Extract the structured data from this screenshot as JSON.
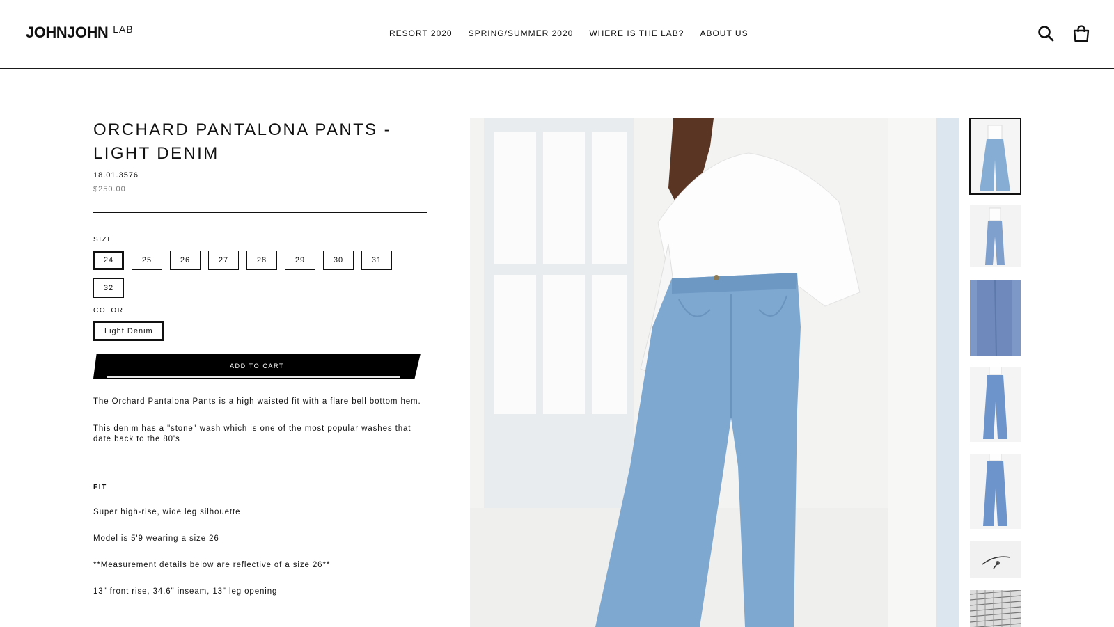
{
  "header": {
    "logo_main": "JOHNJOHN",
    "logo_sub": "LAB",
    "nav": [
      "RESORT 2020",
      "SPRING/SUMMER 2020",
      "WHERE IS THE LAB?",
      "ABOUT US"
    ],
    "icons": [
      "search-icon",
      "cart-icon"
    ]
  },
  "product": {
    "title": "ORCHARD PANTALONA PANTS - LIGHT DENIM",
    "sku": "18.01.3576",
    "price": "$250.00",
    "size_label": "SIZE",
    "sizes": [
      "24",
      "25",
      "26",
      "27",
      "28",
      "29",
      "30",
      "31",
      "32"
    ],
    "selected_size": "24",
    "color_label": "COLOR",
    "color_value": "Light Denim",
    "add_to_cart": "ADD TO CART",
    "description": [
      "The Orchard Pantalona Pants is a high waisted fit with a flare bell bottom hem.",
      "This denim has a \"stone\" wash which is one of the most popular washes that date back to the 80's"
    ],
    "fit_label": "FIT",
    "fit_lines": [
      "Super high-rise, wide leg silhouette",
      "Model is 5'9 wearing a size 26",
      "**Measurement details below are reflective of a size 26**",
      "13\" front rise, 34.6\" inseam, 13\" leg opening"
    ]
  },
  "colors": {
    "text": "#111111",
    "price": "#777777",
    "button_bg": "#000000",
    "denim": "#7ea7cf"
  }
}
